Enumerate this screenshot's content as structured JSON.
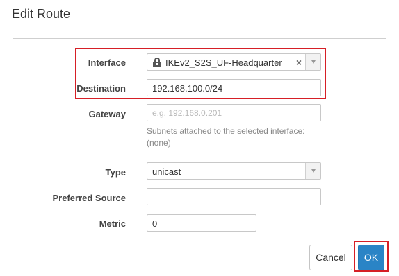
{
  "dialog": {
    "title": "Edit Route",
    "interface": {
      "label": "Interface",
      "value": "IKEv2_S2S_UF-Headquarter",
      "icon": "lock-icon",
      "clear": "×"
    },
    "destination": {
      "label": "Destination",
      "value": "192.168.100.0/24"
    },
    "gateway": {
      "label": "Gateway",
      "placeholder": "e.g. 192.168.0.201",
      "hint_line1": "Subnets attached to the selected interface:",
      "hint_line2": "(none)"
    },
    "type": {
      "label": "Type",
      "value": "unicast"
    },
    "preferred_source": {
      "label": "Preferred Source",
      "value": ""
    },
    "metric": {
      "label": "Metric",
      "value": "0"
    },
    "buttons": {
      "cancel": "Cancel",
      "ok": "OK"
    }
  },
  "colors": {
    "highlight": "#d61f26",
    "primary": "#2a84c6"
  }
}
